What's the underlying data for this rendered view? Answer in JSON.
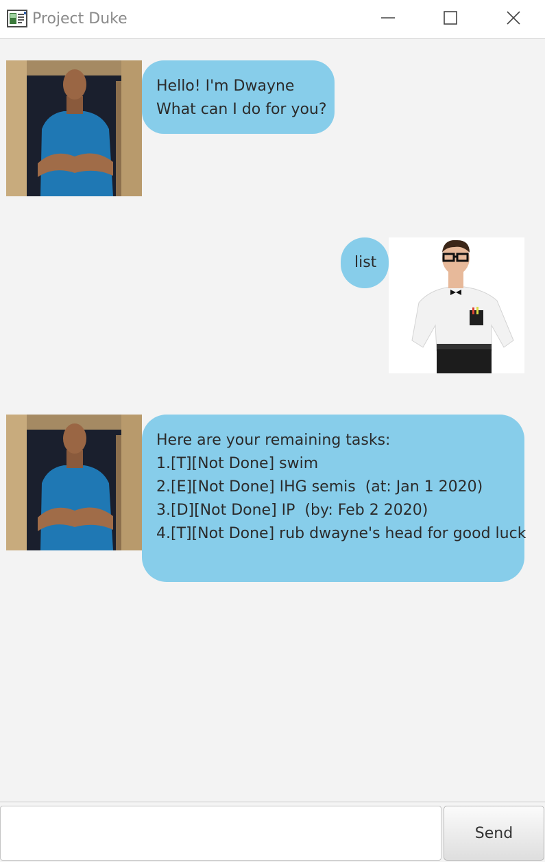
{
  "window": {
    "title": "Project Duke"
  },
  "messages": [
    {
      "sender": "bot",
      "avatar": "dwayne-photo",
      "lines": [
        "Hello! I'm Dwayne",
        "What can I do for you?"
      ]
    },
    {
      "sender": "user",
      "avatar": "nerd-user-photo",
      "lines": [
        "list"
      ]
    },
    {
      "sender": "bot",
      "avatar": "dwayne-photo",
      "lines": [
        "Here are your remaining tasks:",
        "1.[T][Not Done] swim",
        "2.[E][Not Done] IHG semis  (at: Jan 1 2020)",
        "3.[D][Not Done] IP  (by: Feb 2 2020)",
        "4.[T][Not Done] rub dwayne's head for good luck"
      ]
    }
  ],
  "input": {
    "value": "",
    "placeholder": ""
  },
  "send_button": {
    "label": "Send"
  },
  "colors": {
    "bubble": "#87cdea",
    "background": "#f3f3f3",
    "titlebar": "#ffffff"
  },
  "icons": {
    "app": "app-window-icon",
    "minimize": "minimize-icon",
    "maximize": "maximize-icon",
    "close": "close-icon"
  }
}
